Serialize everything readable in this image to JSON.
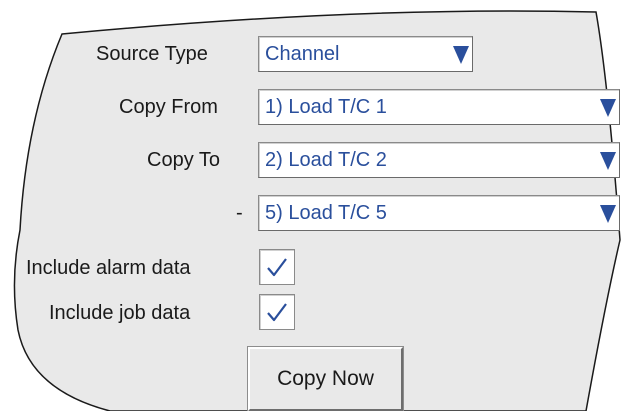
{
  "form": {
    "source_type": {
      "label": "Source Type",
      "value": "Channel"
    },
    "copy_from": {
      "label": "Copy From",
      "value": "1) Load T/C 1"
    },
    "copy_to": {
      "label": "Copy To",
      "value": "2) Load T/C 2"
    },
    "range_end": {
      "label": "-",
      "value": "5) Load T/C 5"
    },
    "include_alarm": {
      "label": "Include alarm data",
      "checked": true
    },
    "include_job": {
      "label": "Include job data",
      "checked": true
    },
    "copy_now_label": "Copy Now"
  },
  "colors": {
    "value_text": "#2a4f9c",
    "arrow": "#2a4f9c",
    "panel_background": "#e9e9e9",
    "checkmark": "#2a4f9c"
  },
  "icons": {
    "dropdown": "triangle-down-icon",
    "checkbox": "checkmark-icon"
  }
}
